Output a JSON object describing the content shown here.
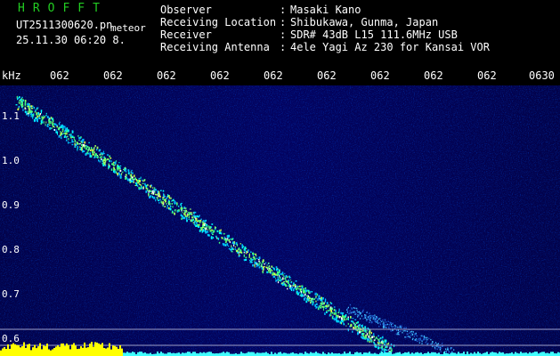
{
  "header": {
    "brand": "HROFFT",
    "filename": "UT2511300620.pn",
    "tag": "meteor",
    "timestamp": "25.11.30 06:20   8.",
    "fields": [
      {
        "label": "Observer",
        "value": "Masaki Kano"
      },
      {
        "label": "Receiving Location",
        "value": "Shibukawa, Gunma, Japan"
      },
      {
        "label": "Receiver",
        "value": "SDR# 43dB L15 111.6MHz USB"
      },
      {
        "label": "Receiving Antenna",
        "value": "4ele Yagi Az 230 for Kansai VOR"
      }
    ],
    "separator": ":"
  },
  "spectrogram": {
    "unit": "kHz",
    "time_ticks": [
      "062",
      "062",
      "062",
      "062",
      "062",
      "062",
      "062",
      "062",
      "062",
      "0630"
    ],
    "freq_ticks": [
      "1.1",
      "1.0",
      "0.9",
      "0.8",
      "0.7",
      "0.6"
    ],
    "trace_start_khz": 1.14,
    "trace_end_khz": 0.58,
    "colors": {
      "background": "#000066",
      "trace": "#aaffff",
      "baseline": "#ffff00",
      "axis_text": "#ffffff"
    }
  }
}
